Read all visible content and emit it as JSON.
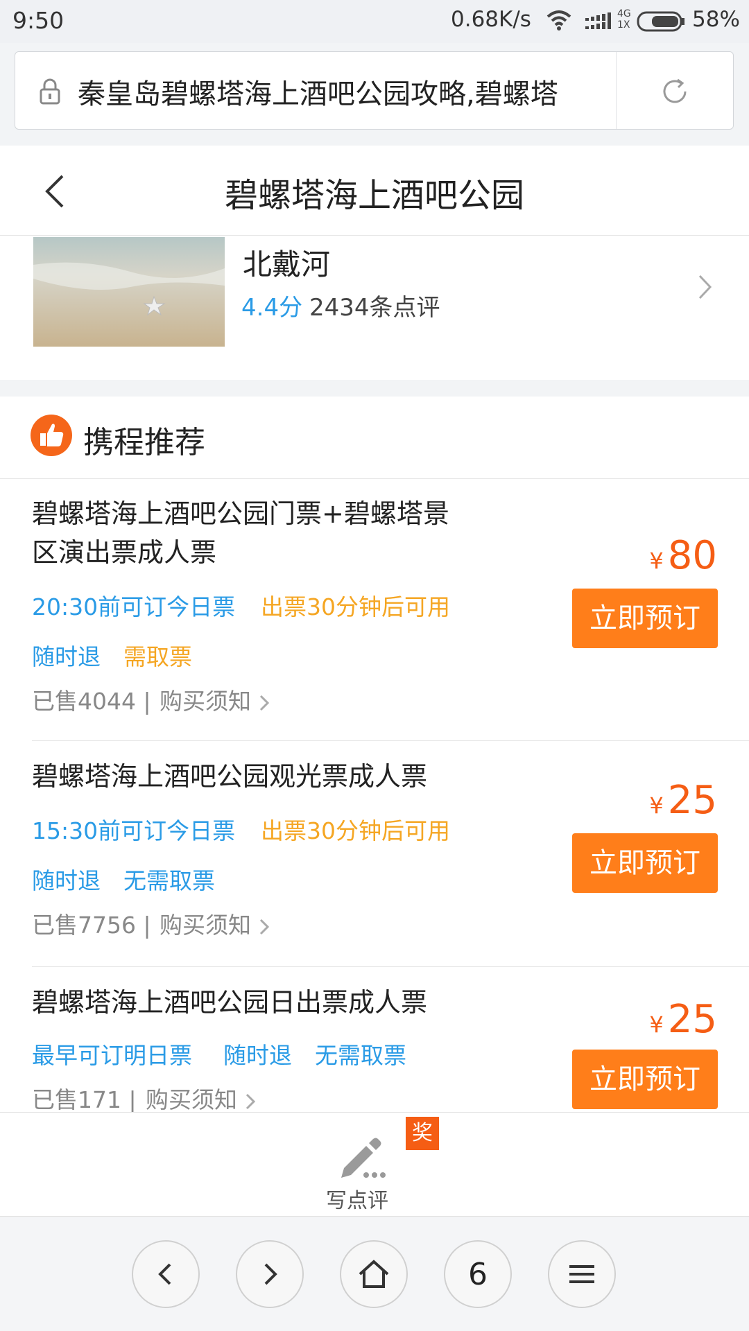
{
  "status_bar": {
    "time": "9:50",
    "speed": "0.68K/s",
    "network_top": "4G",
    "network_bottom": "1X",
    "battery": "58%"
  },
  "url_bar": {
    "url_text": "秦皇岛碧螺塔海上酒吧公园攻略,碧螺塔"
  },
  "header": {
    "title": "碧螺塔海上酒吧公园"
  },
  "destination": {
    "name": "北戴河",
    "score": "4.4分",
    "reviews": "2434条点评"
  },
  "recommend": {
    "title": "携程推荐",
    "products": [
      {
        "name_line1": "碧螺塔海上酒吧公园门票+碧螺塔景",
        "name_line2": "区演出票成人票",
        "tags_row1": [
          {
            "text": "20:30前可订今日票",
            "color": "blue"
          },
          {
            "text": "出票30分钟后可用",
            "color": "orange"
          }
        ],
        "tags_row2": [
          {
            "text": "随时退",
            "color": "blue"
          },
          {
            "text": "需取票",
            "color": "orange"
          }
        ],
        "sold": "已售4044",
        "sep": "|",
        "notice": "购买须知",
        "currency": "¥",
        "price": "80",
        "button": "立即预订"
      },
      {
        "name_line1": "碧螺塔海上酒吧公园观光票成人票",
        "tags_row1": [
          {
            "text": "15:30前可订今日票",
            "color": "blue"
          },
          {
            "text": "出票30分钟后可用",
            "color": "orange"
          }
        ],
        "tags_row2": [
          {
            "text": "随时退",
            "color": "blue"
          },
          {
            "text": "无需取票",
            "color": "blue"
          }
        ],
        "sold": "已售7756",
        "sep": "|",
        "notice": "购买须知",
        "currency": "¥",
        "price": "25",
        "button": "立即预订"
      },
      {
        "name_line1": "碧螺塔海上酒吧公园日出票成人票",
        "tags_row1": [
          {
            "text": "最早可订明日票",
            "color": "blue"
          },
          {
            "text": "随时退",
            "color": "blue"
          },
          {
            "text": "无需取票",
            "color": "blue"
          }
        ],
        "sold": "已售171",
        "sep": "|",
        "notice": "购买须知",
        "currency": "¥",
        "price": "25",
        "button": "立即预订"
      }
    ]
  },
  "write_review": {
    "label": "写点评",
    "badge": "奖"
  },
  "bottom_nav": {
    "tab_count": "6",
    "icons": [
      "back-icon",
      "forward-icon",
      "home-icon",
      "tabs",
      "menu-icon"
    ]
  },
  "colors": {
    "accent_orange": "#ff7e1a",
    "price_orange": "#f55d14",
    "tag_blue": "#2a9be6",
    "tag_yellow": "#f5a623"
  }
}
